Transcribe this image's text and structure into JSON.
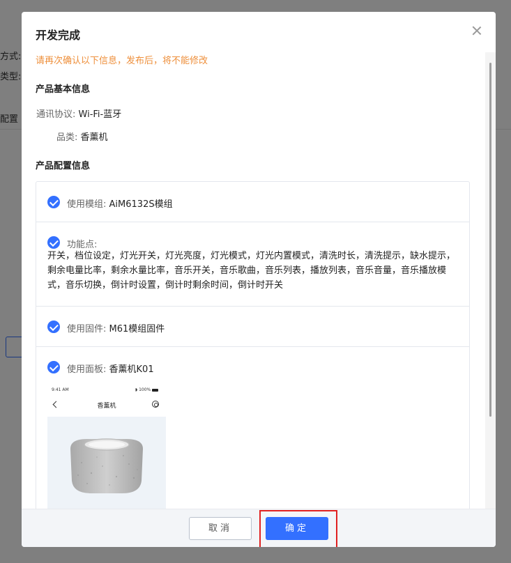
{
  "background": {
    "label_1": "方式:",
    "label_2": "类型:",
    "label_3": "配置"
  },
  "modal": {
    "title": "开发完成",
    "warning": "请再次确认以下信息，发布后，将不能修改",
    "basic_section_title": "产品基本信息",
    "basic_info": {
      "protocol_key": "通讯协议:",
      "protocol_value": "Wi-Fi-蓝牙",
      "category_key": "品类:",
      "category_value": "香薰机"
    },
    "config_section_title": "产品配置信息",
    "config": {
      "module_key": "使用模组:",
      "module_value": "AiM6132S模组",
      "features_key": "功能点:",
      "features_value": "开关，档位设定，灯光开关，灯光亮度，灯光模式，灯光内置模式，清洗时长，清洗提示，缺水提示，剩余电量比率，剩余水量比率，音乐开关，音乐歌曲，音乐列表，播放列表，音乐音量，音乐播放模式，音乐切换，倒计时设置，倒计时剩余时间，倒计时开关",
      "firmware_key": "使用固件:",
      "firmware_value": "M61模组固件",
      "panel_key": "使用面板:",
      "panel_value": "香薰机K01"
    },
    "phone_preview": {
      "time": "9:41 AM",
      "signal": "100%",
      "title": "香薰机"
    },
    "footer": {
      "cancel_label": "取消",
      "confirm_label": "确定"
    }
  },
  "colors": {
    "primary": "#3370ff",
    "warning": "#ee8f3b",
    "highlight": "#e02020"
  }
}
